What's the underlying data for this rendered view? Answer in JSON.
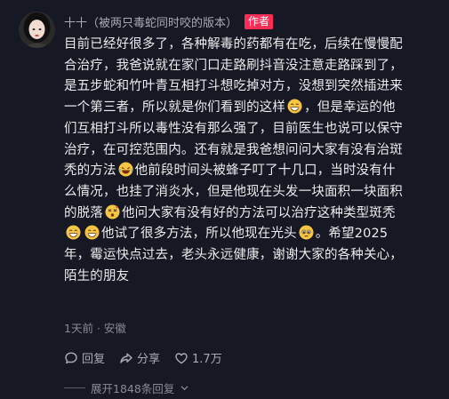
{
  "comment": {
    "username": "十十（被两只毒蛇同时咬的版本）",
    "author_badge": "作者",
    "lines": [
      [
        "目前已经好很多了，各种解毒的药都有在吃，后续在慢慢配"
      ],
      [
        "合治疗，我爸说就在家门口走路刷抖音没注意走路踩到了，"
      ],
      [
        "是五步蛇和竹叶青互相打斗想吃掉对方，没想到突然插进来"
      ],
      [
        "一个第三者，所以就是你们看到的这样",
        "emoji:grin",
        "，但是幸运的他"
      ],
      [
        "们互相打斗所以毒性没有那么强了，目前医生也说可以保守"
      ],
      [
        "治疗，在可控范围内。还有就是我爸想问问大家有没有治斑"
      ],
      [
        "秃的方法",
        "emoji:laugh-cry",
        "他前段时间头被蜂子叮了十几口，当时没有什"
      ],
      [
        "么情况，也挂了消炎水，但是他现在头发一块面积一块面积"
      ],
      [
        "的脱落",
        "emoji:dizzy",
        "他问大家有没有好的方法可以治疗这种类型斑秃"
      ],
      [
        "emoji:grin",
        "emoji:grin",
        "他试了很多方法，所以他现在光头",
        "emoji:pleading",
        "。希望2025"
      ],
      [
        "年，霉运快点过去，老头永远健康，谢谢大家的各种关心，"
      ],
      [
        "陌生的朋友"
      ]
    ],
    "meta": "1天前 · 安徽"
  },
  "actions": {
    "reply": "回复",
    "share": "分享",
    "like_count": "1.7万"
  },
  "expand_replies": "展开1848条回复",
  "colors": {
    "background": "#161823",
    "badge": "#fe2c55",
    "text": "#ececee",
    "muted": "#8a8b92"
  },
  "icons": [
    "reply-icon",
    "share-icon",
    "heart-icon",
    "chevron-down-icon"
  ]
}
